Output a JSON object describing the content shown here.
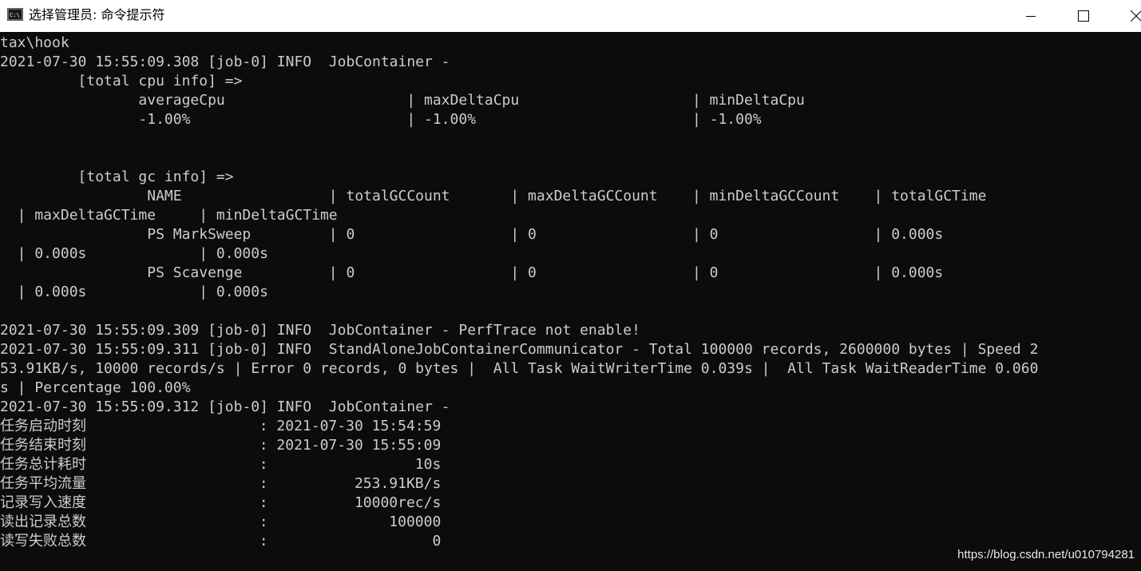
{
  "window": {
    "title": "选择管理员: 命令提示符",
    "icon": "cmd-icon",
    "controls": [
      "minimize-icon",
      "maximize-icon",
      "close-icon"
    ]
  },
  "console": {
    "lines": [
      "tax\\hook",
      "2021-07-30 15:55:09.308 [job-0] INFO  JobContainer -",
      "         [total cpu info] =>",
      "                averageCpu                     | maxDeltaCpu                    | minDeltaCpu",
      "                -1.00%                         | -1.00%                         | -1.00%",
      "",
      "",
      "         [total gc info] =>",
      "                 NAME                 | totalGCCount       | maxDeltaGCCount    | minDeltaGCCount    | totalGCTime",
      "  | maxDeltaGCTime     | minDeltaGCTime",
      "                 PS MarkSweep         | 0                  | 0                  | 0                  | 0.000s",
      "  | 0.000s             | 0.000s",
      "                 PS Scavenge          | 0                  | 0                  | 0                  | 0.000s",
      "  | 0.000s             | 0.000s",
      "",
      "2021-07-30 15:55:09.309 [job-0] INFO  JobContainer - PerfTrace not enable!",
      "2021-07-30 15:55:09.311 [job-0] INFO  StandAloneJobContainerCommunicator - Total 100000 records, 2600000 bytes | Speed 2",
      "53.91KB/s, 10000 records/s | Error 0 records, 0 bytes |  All Task WaitWriterTime 0.039s |  All Task WaitReaderTime 0.060",
      "s | Percentage 100.00%",
      "2021-07-30 15:55:09.312 [job-0] INFO  JobContainer -",
      "任务启动时刻                    : 2021-07-30 15:54:59",
      "任务结束时刻                    : 2021-07-30 15:55:09",
      "任务总计耗时                    :                 10s",
      "任务平均流量                    :          253.91KB/s",
      "记录写入速度                    :          10000rec/s",
      "读出记录总数                    :              100000",
      "读写失败总数                    :                   0"
    ]
  },
  "watermark": "https://blog.csdn.net/u010794281"
}
